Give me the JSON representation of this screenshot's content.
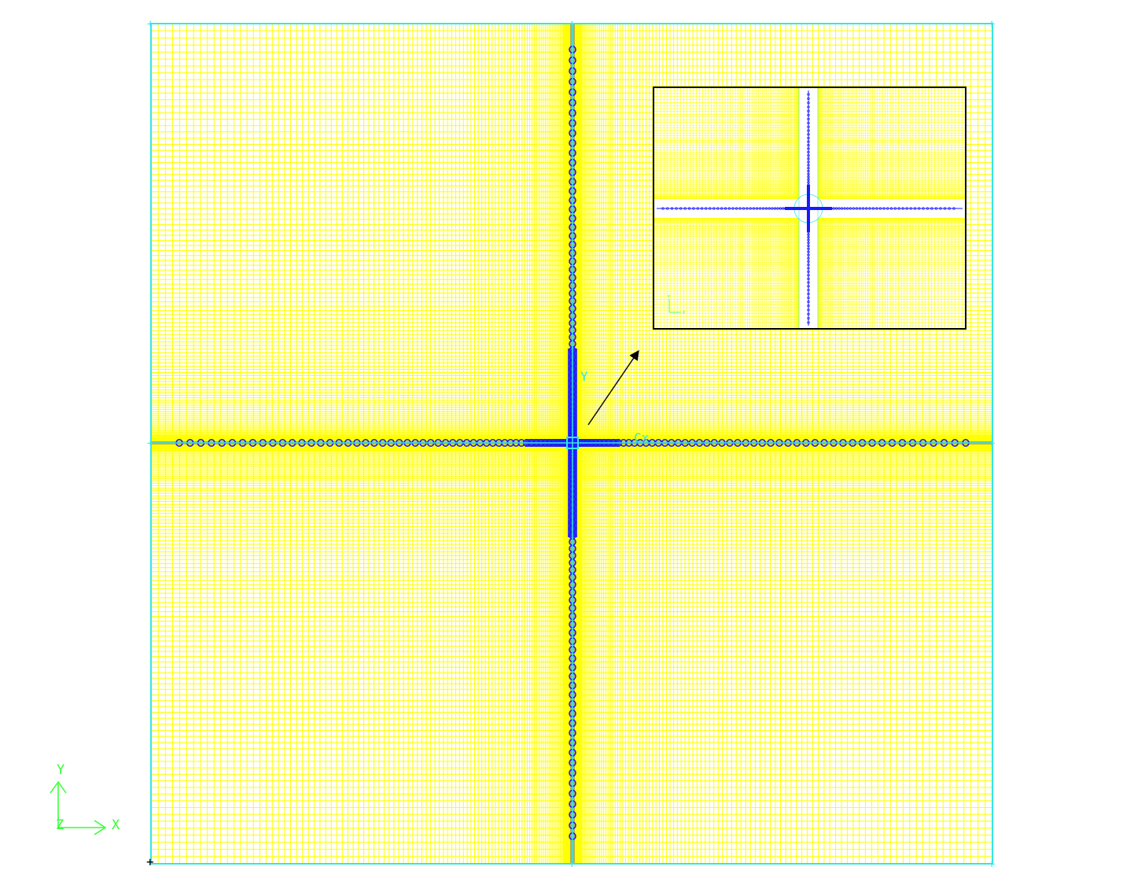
{
  "figure": {
    "colors": {
      "background": "#ffffff",
      "mesh": "#ffff00",
      "boundary": "#33e6e6",
      "markers": "#1a1aff",
      "axis_triad": "#33ff33",
      "inset_frame": "#000000",
      "leader_arrow": "#000000"
    },
    "main_view": {
      "origin_marker": "+",
      "center_labels": {
        "y": "Y",
        "x": "Cx"
      }
    },
    "axis_triad": {
      "y": "Y",
      "z": "Z",
      "x": "X"
    },
    "inset": {
      "description_icon": "zoom-inset",
      "axis_triad": {
        "y": "Y",
        "x": "X"
      }
    }
  }
}
